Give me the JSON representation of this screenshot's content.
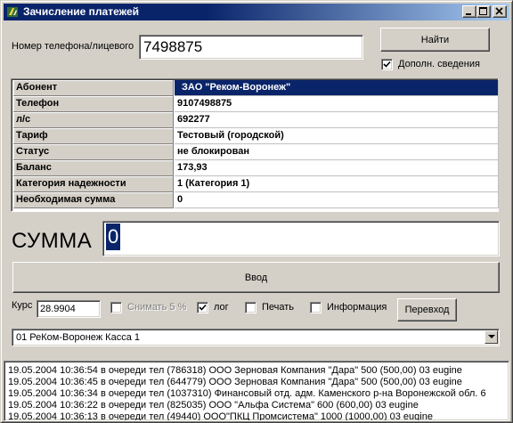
{
  "window": {
    "title": "Зачисление платежей",
    "icon": "app-icon"
  },
  "search": {
    "label": "Номер телефона/лицевого",
    "value": "7498875",
    "find_button": "Найти",
    "extra_info_label": "Дополн. сведения",
    "extra_info_checked": true
  },
  "info": {
    "rows": [
      {
        "label": "Абонент",
        "value": "ЗАО \"Реком-Воронеж\""
      },
      {
        "label": "Телефон",
        "value": "9107498875"
      },
      {
        "label": "л/с",
        "value": "692277"
      },
      {
        "label": "Тариф",
        "value": "Тестовый (городской)"
      },
      {
        "label": "Статус",
        "value": "не блокирован"
      },
      {
        "label": "Баланс",
        "value": "173,93"
      },
      {
        "label": "Категория надежности",
        "value": "1 (Категория 1)"
      },
      {
        "label": "Необходимая сумма",
        "value": "0"
      }
    ]
  },
  "payment": {
    "summa_label": "СУММА",
    "summa_value": "0",
    "enter_button": "Ввод"
  },
  "options": {
    "rate_label": "Курс",
    "rate_value": "28.9904",
    "withhold_label": "Снимать 5 %",
    "withhold_checked": false,
    "log_label": "лог",
    "log_checked": true,
    "print_label": "Печать",
    "print_checked": false,
    "info_label": "Информация",
    "info_checked": false,
    "transfer_button": "Перевход"
  },
  "cashbox": {
    "selected": "01 РеКом-Воронеж Касса 1"
  },
  "log": {
    "lines": [
      "19.05.2004 10:36:54 в очереди  тел  (786318)  ООО Зерновая Компания \"Дара\"  500 (500,00)  03 eugine",
      "19.05.2004 10:36:45 в очереди  тел  (644779)  ООО Зерновая Компания \"Дара\"  500 (500,00)  03 eugine",
      "19.05.2004 10:36:34 в очереди  тел  (1037310)  Финансовый отд. адм. Каменского р-на Воронежской обл.  6",
      "19.05.2004 10:36:22 в очереди  тел  (825035)  ООО \"Альфа Система\"  600 (600,00)  03 eugine",
      "19.05.2004 10:36:13 в очереди  тел  (49440)  ООО\"ПКЦ Промсистема\"  1000 (1000,00)  03 eugine"
    ]
  }
}
